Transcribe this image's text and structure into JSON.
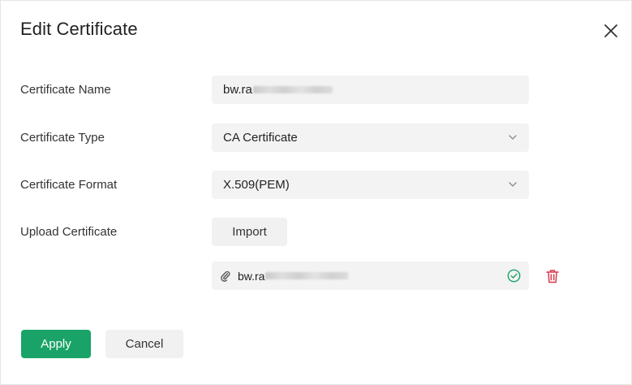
{
  "dialog": {
    "title": "Edit Certificate",
    "close_icon": "close-icon"
  },
  "form": {
    "name": {
      "label": "Certificate Name",
      "value": "bw.ra"
    },
    "type": {
      "label": "Certificate Type",
      "value": "CA Certificate",
      "icon": "chevron-down-icon"
    },
    "format": {
      "label": "Certificate Format",
      "value": "X.509(PEM)",
      "icon": "chevron-down-icon"
    },
    "upload": {
      "label": "Upload Certificate",
      "import_label": "Import",
      "file_name": "bw.ra",
      "file_icon": "paperclip-icon",
      "status_icon": "check-circle-icon",
      "delete_icon": "trash-icon"
    }
  },
  "footer": {
    "apply_label": "Apply",
    "cancel_label": "Cancel"
  },
  "colors": {
    "primary": "#1aa368",
    "delete": "#d9394e",
    "success": "#1aa368"
  }
}
